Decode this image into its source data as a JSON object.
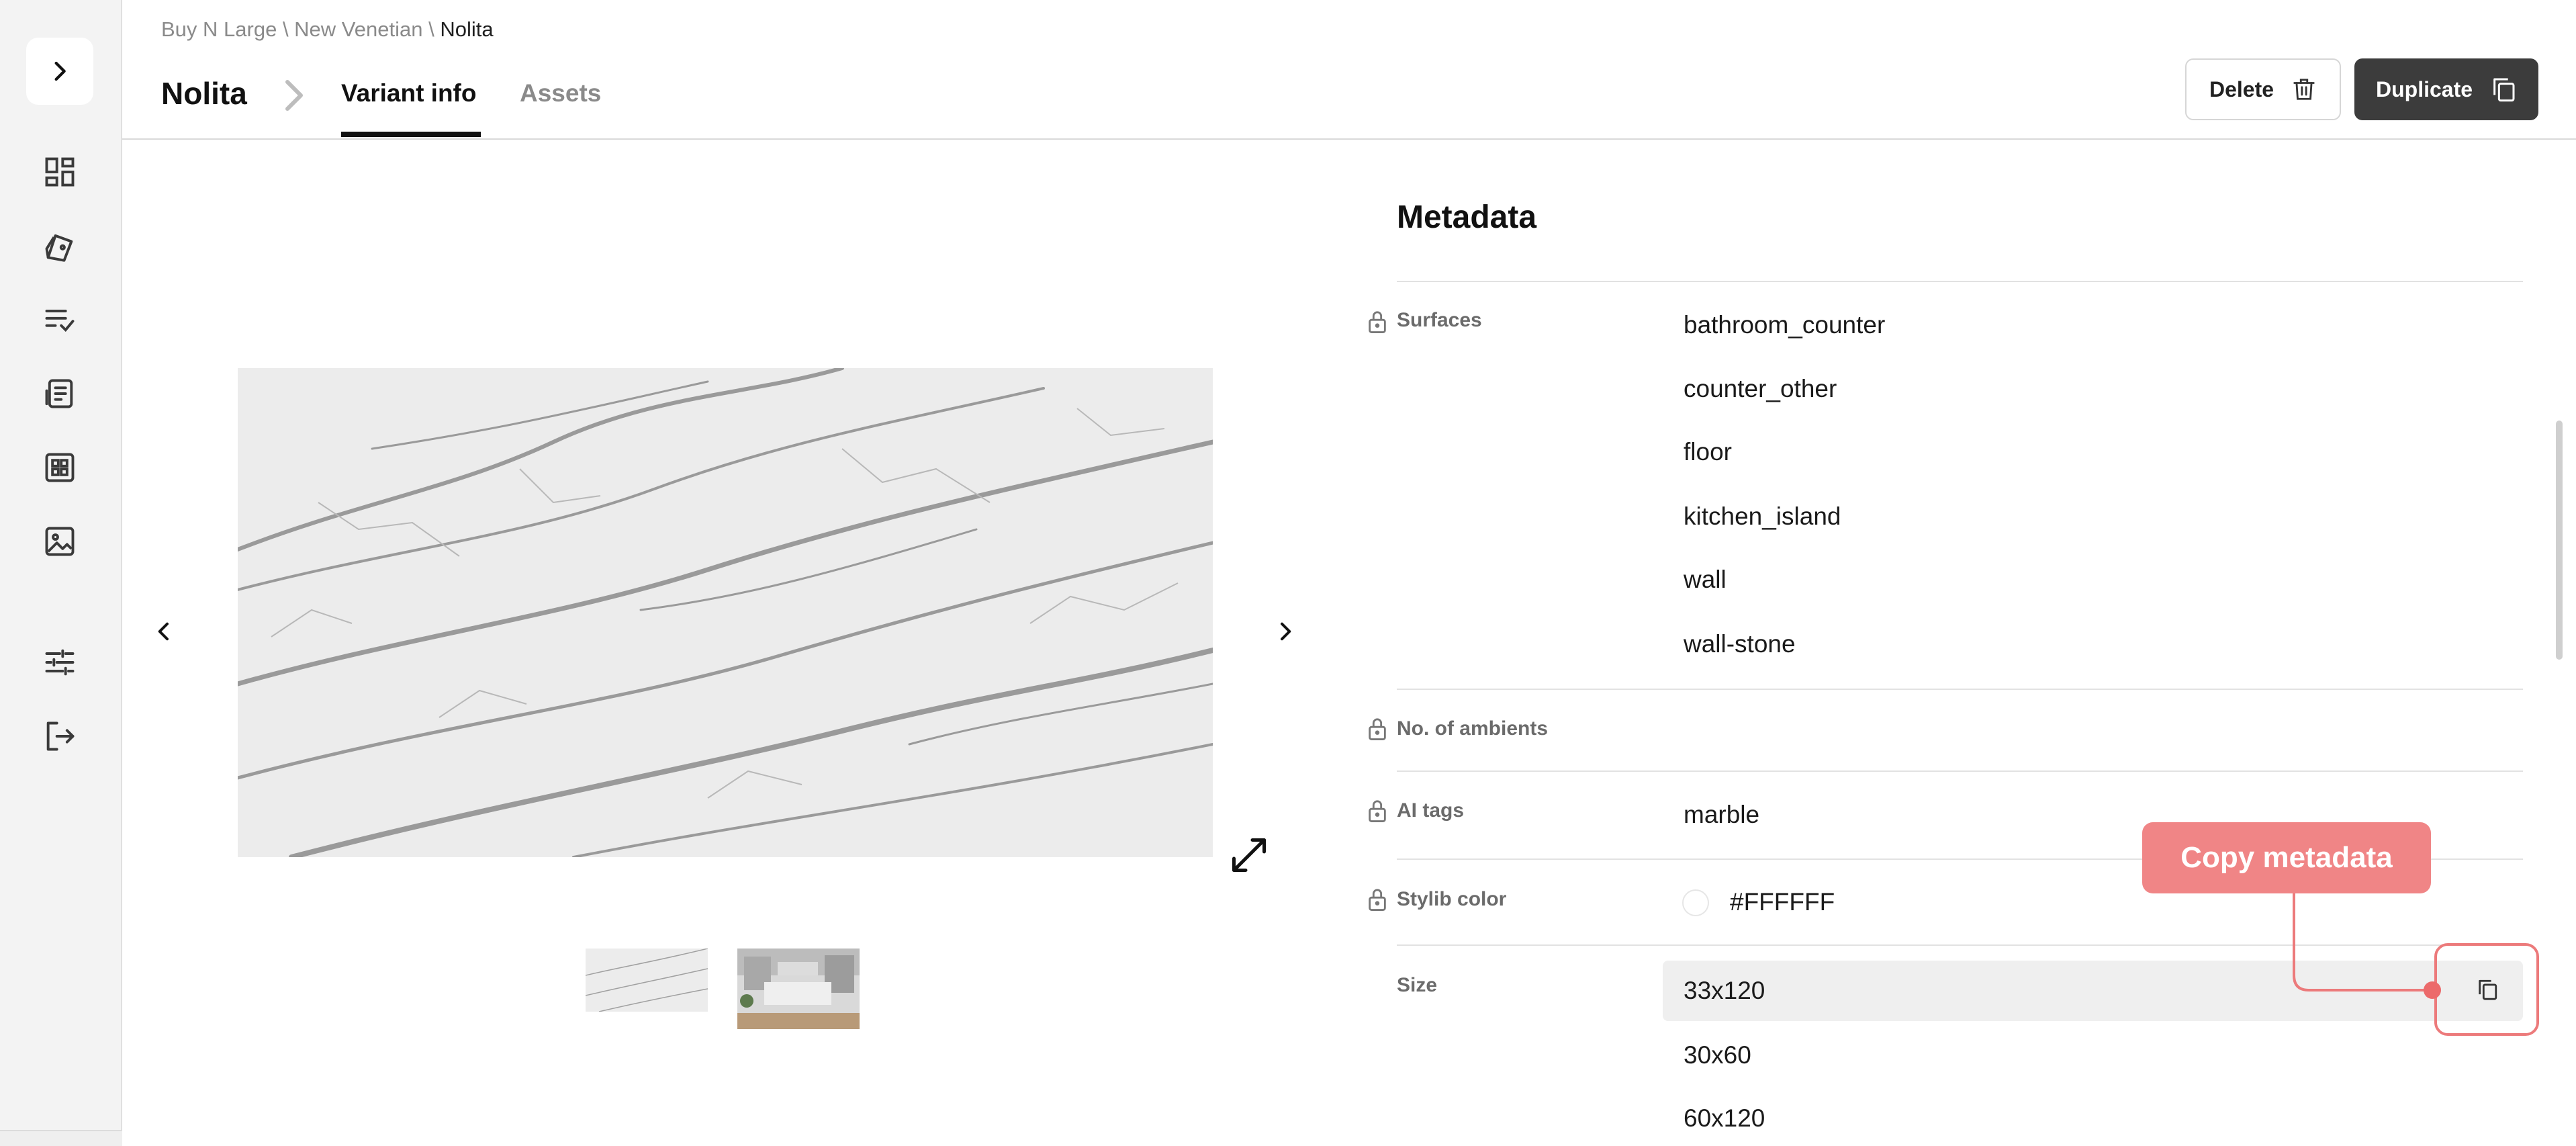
{
  "sidebar": {
    "toggle_icon": "chevron-right-icon",
    "nav_icons": [
      "dashboard-icon",
      "swatch-catalog-icon",
      "checklist-icon",
      "orders-icon",
      "grid-apps-icon",
      "image-icon",
      "sliders-icon",
      "logout-icon"
    ]
  },
  "header": {
    "breadcrumb": {
      "part1": "Buy N Large",
      "sep1": " \\ ",
      "part2": "New Venetian",
      "sep2": " \\ ",
      "current": "Nolita"
    },
    "title": "Nolita",
    "tabs": [
      {
        "label": "Variant info",
        "active": true
      },
      {
        "label": "Assets",
        "active": false
      }
    ],
    "delete_label": "Delete",
    "duplicate_label": "Duplicate"
  },
  "viewer": {
    "thumbnails": [
      "marble-slab",
      "kitchen-scene"
    ]
  },
  "metadata": {
    "title": "Metadata",
    "surfaces_label": "Surfaces",
    "surfaces": [
      "bathroom_counter",
      "counter_other",
      "floor",
      "kitchen_island",
      "wall",
      "wall-stone"
    ],
    "ambients_label": "No. of ambients",
    "ambients_value": "",
    "ai_tags_label": "AI tags",
    "ai_tags": [
      "marble"
    ],
    "color_label": "Stylib color",
    "color_value": "#FFFFFF",
    "size_label": "Size",
    "sizes": [
      "33x120",
      "30x60",
      "60x120"
    ]
  },
  "tooltip": {
    "text": "Copy metadata"
  },
  "colors": {
    "accent": "#f08586",
    "dark_button": "#3c3c3c",
    "sidebar_bg": "#f3f3f3"
  }
}
